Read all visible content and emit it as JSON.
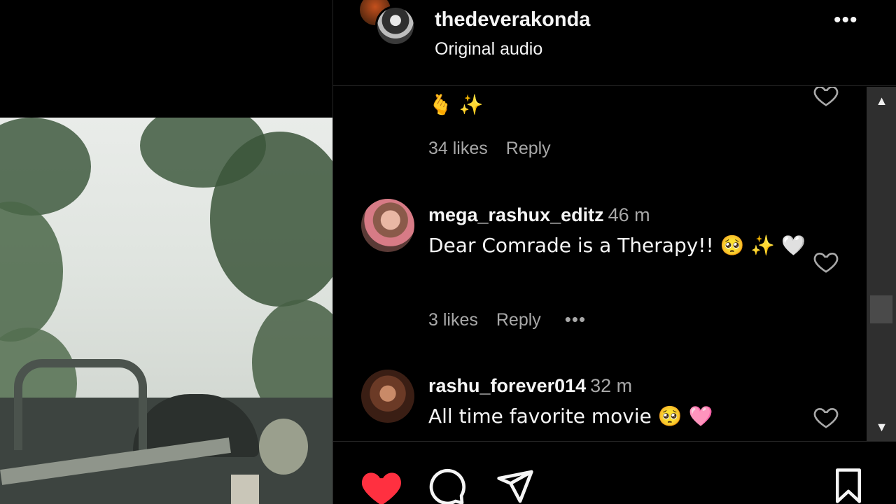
{
  "post": {
    "username": "thedeverakonda",
    "audio": "Original audio",
    "more_label": "•••"
  },
  "comments": [
    {
      "username": "",
      "time": "",
      "text": "🫰 ✨",
      "likes": "34 likes",
      "reply": "Reply"
    },
    {
      "username": "mega_rashux_editz",
      "time": "46 m",
      "text": "Dear Comrade is a Therapy!! 🥺 ✨ 🤍",
      "likes": "3 likes",
      "reply": "Reply",
      "more": "•••"
    },
    {
      "username": "rashu_forever014",
      "time": "32 m",
      "text": "All time favorite movie 🥺 🩷"
    }
  ],
  "scrollbar": {
    "up": "▲",
    "down": "▼"
  },
  "icons": {
    "like": "heart-filled-icon",
    "comment": "comment-icon",
    "share": "send-icon",
    "save": "bookmark-icon"
  },
  "colors": {
    "like_red": "#ff3040",
    "text": "#f5f5f5",
    "muted": "#a8a8a8"
  }
}
